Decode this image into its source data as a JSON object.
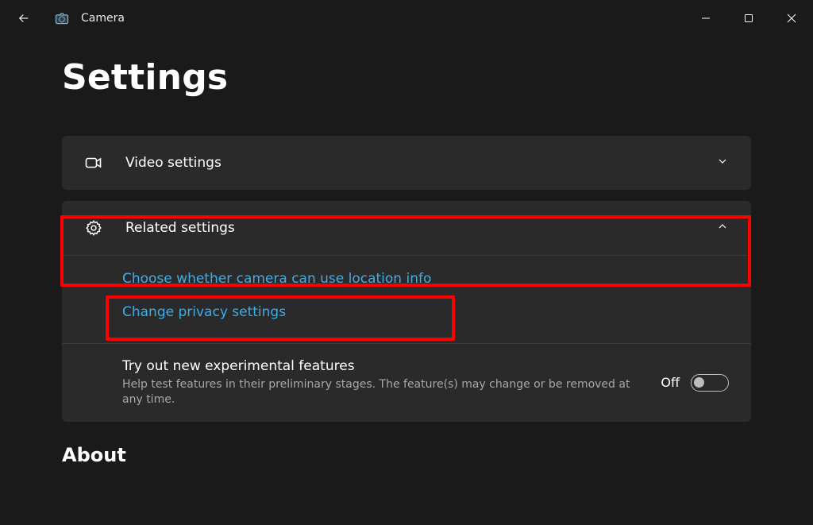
{
  "titlebar": {
    "app_name": "Camera"
  },
  "page": {
    "title": "Settings"
  },
  "cards": {
    "video": {
      "label": "Video settings"
    },
    "related": {
      "label": "Related settings",
      "links": {
        "location": "Choose whether camera can use location info",
        "privacy": "Change privacy settings"
      }
    },
    "experimental": {
      "title": "Try out new experimental features",
      "description": "Help test features in their preliminary stages. The feature(s) may change or be removed at any time.",
      "toggle_label": "Off"
    }
  },
  "about": {
    "heading": "About"
  }
}
